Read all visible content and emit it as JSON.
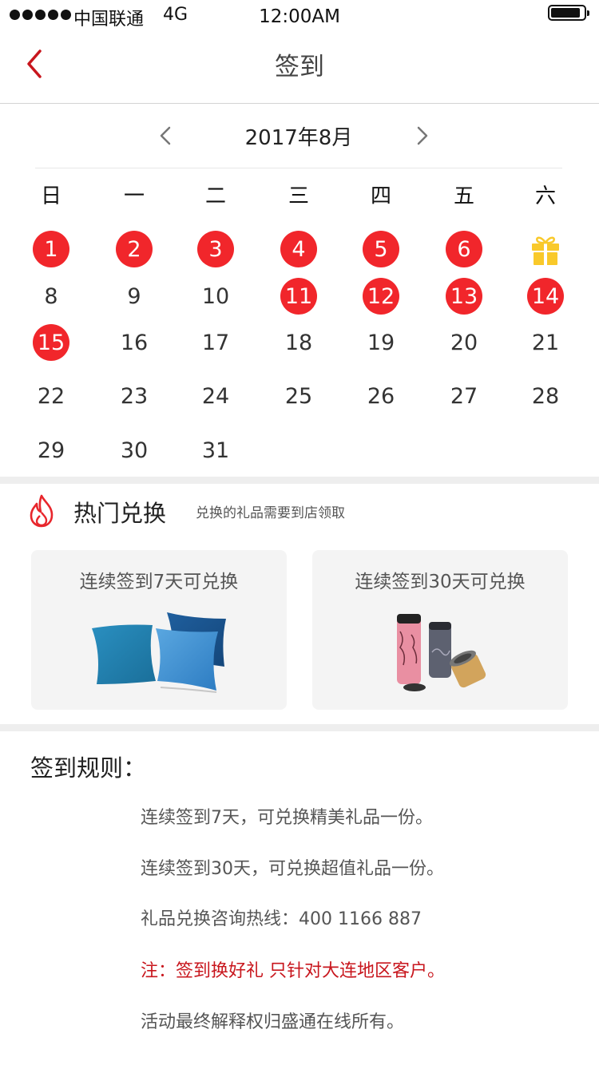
{
  "status_bar": {
    "carrier": "中国联通",
    "network": "4G",
    "time": "12:00AM"
  },
  "nav": {
    "title": "签到",
    "back_icon": "chevron-left-icon",
    "back_color": "#c8161d"
  },
  "calendar": {
    "month_label": "2017年8月",
    "prev_icon": "chevron-left-icon",
    "next_icon": "chevron-right-icon",
    "weekdays": [
      "日",
      "一",
      "二",
      "三",
      "四",
      "五",
      "六"
    ],
    "signed_color": "#f1262b",
    "gift_color": "#f9c92a",
    "rows": [
      [
        {
          "day": "1",
          "signed": true
        },
        {
          "day": "2",
          "signed": true
        },
        {
          "day": "3",
          "signed": true
        },
        {
          "day": "4",
          "signed": true
        },
        {
          "day": "5",
          "signed": true
        },
        {
          "day": "6",
          "signed": true
        },
        {
          "gift": true
        }
      ],
      [
        {
          "day": "8",
          "signed": false
        },
        {
          "day": "9",
          "signed": false
        },
        {
          "day": "10",
          "signed": false
        },
        {
          "day": "11",
          "signed": true
        },
        {
          "day": "12",
          "signed": true
        },
        {
          "day": "13",
          "signed": true
        },
        {
          "day": "14",
          "signed": true
        }
      ],
      [
        {
          "day": "15",
          "signed": true
        },
        {
          "day": "16",
          "signed": false
        },
        {
          "day": "17",
          "signed": false
        },
        {
          "day": "18",
          "signed": false
        },
        {
          "day": "19",
          "signed": false
        },
        {
          "day": "20",
          "signed": false
        },
        {
          "day": "21",
          "signed": false
        }
      ],
      [
        {
          "day": "22",
          "signed": false
        },
        {
          "day": "23",
          "signed": false
        },
        {
          "day": "24",
          "signed": false
        },
        {
          "day": "25",
          "signed": false
        },
        {
          "day": "26",
          "signed": false
        },
        {
          "day": "27",
          "signed": false
        },
        {
          "day": "28",
          "signed": false
        }
      ],
      [
        {
          "day": "29",
          "signed": false
        },
        {
          "day": "30",
          "signed": false
        },
        {
          "day": "31",
          "signed": false
        }
      ]
    ]
  },
  "hot_exchange": {
    "title": "热门兑换",
    "subtitle": "兑换的礼品需要到店领取",
    "icon": "flame-icon",
    "cards": [
      {
        "title": "连续签到7天可兑换",
        "image": "pillow-image"
      },
      {
        "title": "连续签到30天可兑换",
        "image": "bottle-image"
      }
    ]
  },
  "rules": {
    "title": "签到规则：",
    "lines": [
      {
        "text": "连续签到7天，可兑换精美礼品一份。",
        "red": false
      },
      {
        "text": "连续签到30天，可兑换超值礼品一份。",
        "red": false
      },
      {
        "text": "礼品兑换咨询热线：400 1166 887",
        "red": false
      },
      {
        "text": "注：签到换好礼 只针对大连地区客户。",
        "red": true
      },
      {
        "text": "活动最终解释权归盛通在线所有。",
        "red": false
      }
    ]
  }
}
